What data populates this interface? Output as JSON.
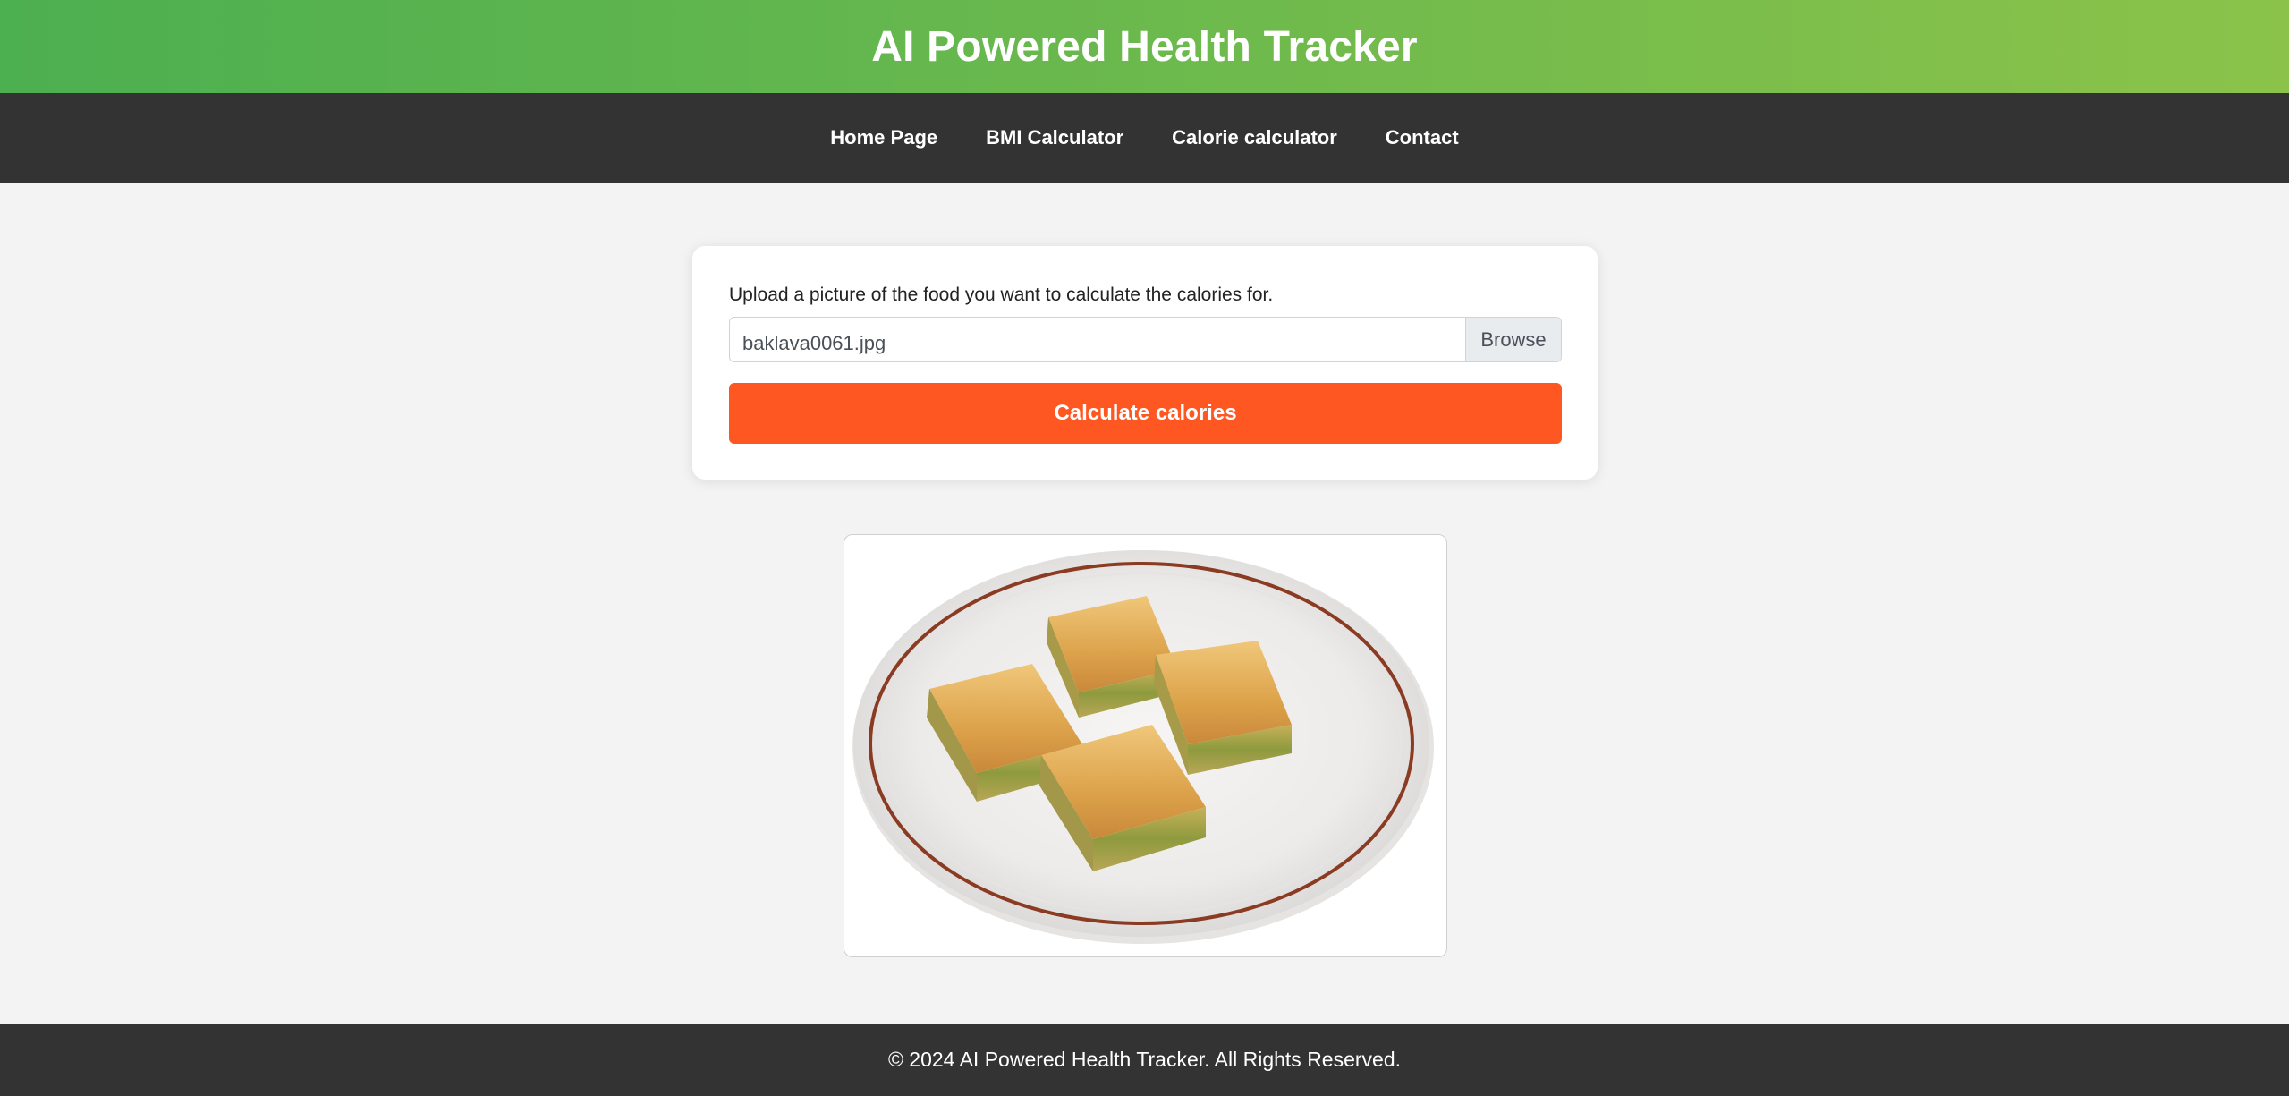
{
  "header": {
    "title": "AI Powered Health Tracker"
  },
  "nav": {
    "items": [
      {
        "label": "Home Page"
      },
      {
        "label": "BMI Calculator"
      },
      {
        "label": "Calorie calculator"
      },
      {
        "label": "Contact"
      }
    ]
  },
  "upload": {
    "label": "Upload a picture of the food you want to calculate the calories for.",
    "file_name": "baklava0061.jpg",
    "browse_label": "Browse",
    "submit_label": "Calculate calories"
  },
  "preview": {
    "icon": "baklava-plate-image"
  },
  "footer": {
    "text": "© 2024 AI Powered Health Tracker. All Rights Reserved."
  },
  "colors": {
    "header_gradient_start": "#4caf50",
    "header_gradient_end": "#8bc34a",
    "nav_bg": "#333333",
    "page_bg": "#f3f3f3",
    "accent_button": "#ff5722",
    "footer_bg": "#333333"
  }
}
